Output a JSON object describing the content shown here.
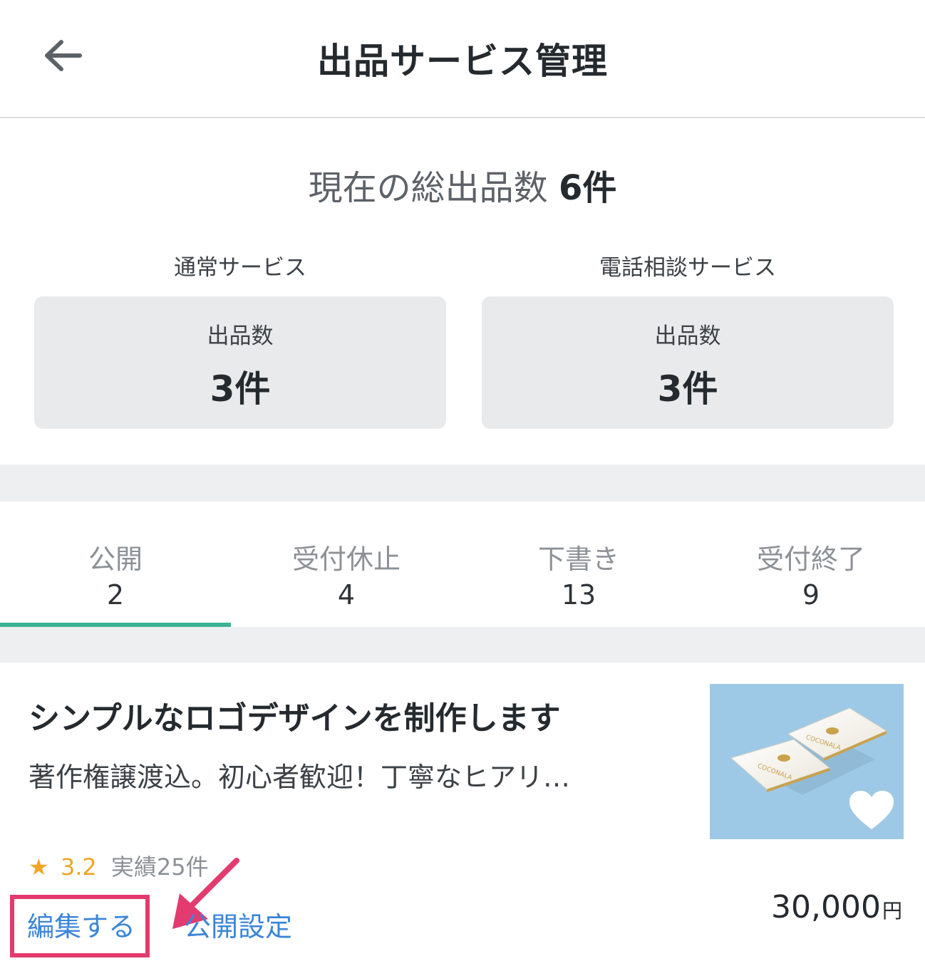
{
  "header": {
    "title": "出品サービス管理",
    "back_icon": "arrow-left-icon"
  },
  "total": {
    "label": "現在の総出品数",
    "count": "6件"
  },
  "summary": [
    {
      "section": "通常サービス",
      "label": "出品数",
      "value": "3件"
    },
    {
      "section": "電話相談サービス",
      "label": "出品数",
      "value": "3件"
    }
  ],
  "tabs": [
    {
      "label": "公開",
      "count": "2",
      "active": true
    },
    {
      "label": "受付休止",
      "count": "4",
      "active": false
    },
    {
      "label": "下書き",
      "count": "13",
      "active": false
    },
    {
      "label": "受付終了",
      "count": "9",
      "active": false
    }
  ],
  "service": {
    "title": "シンプルなロゴデザインを制作します",
    "description": "著作権譲渡込。初心者歓迎！丁寧なヒアリ…",
    "thumbnail_text": "COCONALA",
    "rating_star": "★",
    "rating": "3.2",
    "achievements": "実績25件",
    "edit_label": "編集する",
    "publish_label": "公開設定",
    "price": "30,000",
    "currency": "円"
  },
  "colors": {
    "accent": "#3bb293",
    "link": "#3b85d8",
    "highlight": "#e33b6f",
    "star": "#f1a524"
  }
}
